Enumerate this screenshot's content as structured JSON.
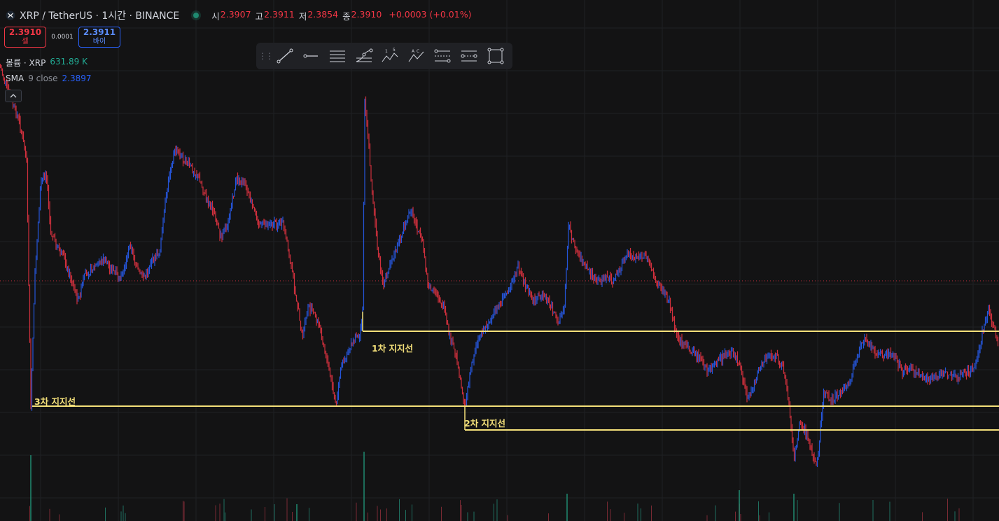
{
  "header": {
    "symbol_title": "XRP / TetherUS · 1시간 · BINANCE",
    "ohlc": [
      {
        "label": "시",
        "value": "2.3907"
      },
      {
        "label": "고",
        "value": "2.3911"
      },
      {
        "label": "저",
        "value": "2.3854"
      },
      {
        "label": "종",
        "value": "2.3910"
      }
    ],
    "change": "+0.0003 (+0.01%)"
  },
  "trade": {
    "sell_price": "2.3910",
    "sell_label": "셀",
    "spread": "0.0001",
    "buy_price": "2.3911",
    "buy_label": "바이"
  },
  "indicators": {
    "volume": {
      "name": "볼륨 · XRP",
      "value": "631.89 K"
    },
    "sma": {
      "name": "SMA",
      "params": "9 close",
      "value": "2.3897"
    }
  },
  "toolbar": {
    "tools": [
      "trend-line",
      "ray",
      "parallel-channel",
      "fib-retracement",
      "xabcd-pattern",
      "abcd-pattern",
      "date-price-range",
      "price-range",
      "rectangle"
    ]
  },
  "support_labels": {
    "first": "1차 지지선",
    "second": "2차 지지선",
    "third": "3차 지지선"
  },
  "colors": {
    "background": "#131314",
    "bull": "#2962ff",
    "bear": "#f23645",
    "support_line": "#f4e07a",
    "volume": "#22ab94"
  }
}
